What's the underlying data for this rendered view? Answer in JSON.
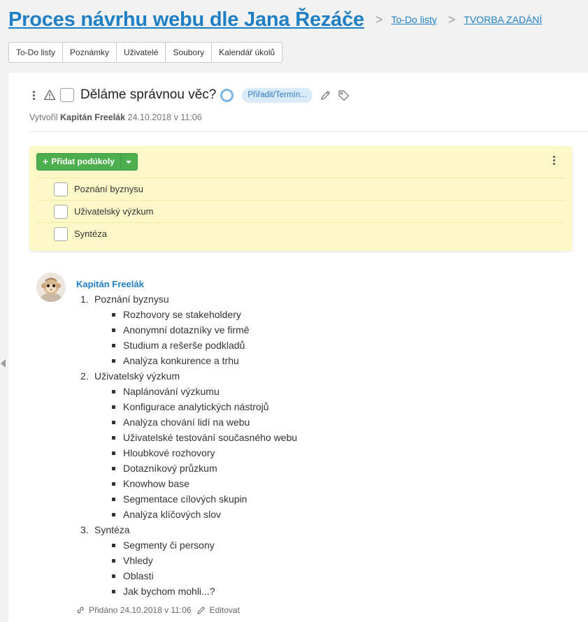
{
  "header": {
    "project_title": "Proces návrhu webu dle Jana Řezáče",
    "breadcrumbs": [
      "To-Do listy",
      "TVORBA ZADÁNÍ"
    ]
  },
  "tabs": [
    "To-Do listy",
    "Poznámky",
    "Uživatelé",
    "Soubory",
    "Kalendář úkolů"
  ],
  "task": {
    "title": "Děláme správnou věc?",
    "assign_label": "Přiřadit/Termín...",
    "created_prefix": "Vytvořil",
    "created_by": "Kapitán Freelák",
    "created_at": "24.10.2018 v 11:06"
  },
  "subtasks": {
    "add_label": "Přidat podúkoly",
    "items": [
      "Poznání byznysu",
      "Uživatelský výzkum",
      "Syntéza"
    ]
  },
  "comment": {
    "author": "Kapitán Freelák",
    "sections": [
      {
        "num": "1.",
        "title": "Poznání byznysu",
        "bullets": [
          "Rozhovory se stakeholdery",
          "Anonymní dotazníky ve firmě",
          "Studium a rešerše podkladů",
          "Analýza konkurence a trhu"
        ]
      },
      {
        "num": "2.",
        "title": "Uživatelský výzkum",
        "bullets": [
          "Naplánování výzkumu",
          "Konfigurace analytických nástrojů",
          "Analýza chování lidí na webu",
          "Uživatelské testování současného webu",
          "Hloubkové rozhovory",
          "Dotazníkový průzkum",
          "Knowhow base",
          "Segmentace cílových skupin",
          "Analýza klíčových slov"
        ]
      },
      {
        "num": "3.",
        "title": "Syntéza",
        "bullets": [
          "Segmenty či persony",
          "Vhledy",
          "Oblasti",
          "Jak bychom mohli...?"
        ]
      }
    ],
    "added_label": "Přidáno 24.10.2018 v 11:06",
    "edit_label": "Editovat"
  },
  "colors": {
    "link": "#1f7fc4",
    "subtask_bg": "#fcf8c8",
    "add_button": "#4cae4c",
    "assign_pill_bg": "#d9eaf9"
  },
  "icons": [
    "kebab-icon",
    "warning-icon",
    "ring-icon",
    "pencil-icon",
    "tag-icon",
    "plus-icon",
    "caret-down-icon",
    "link-icon",
    "edit-icon"
  ]
}
